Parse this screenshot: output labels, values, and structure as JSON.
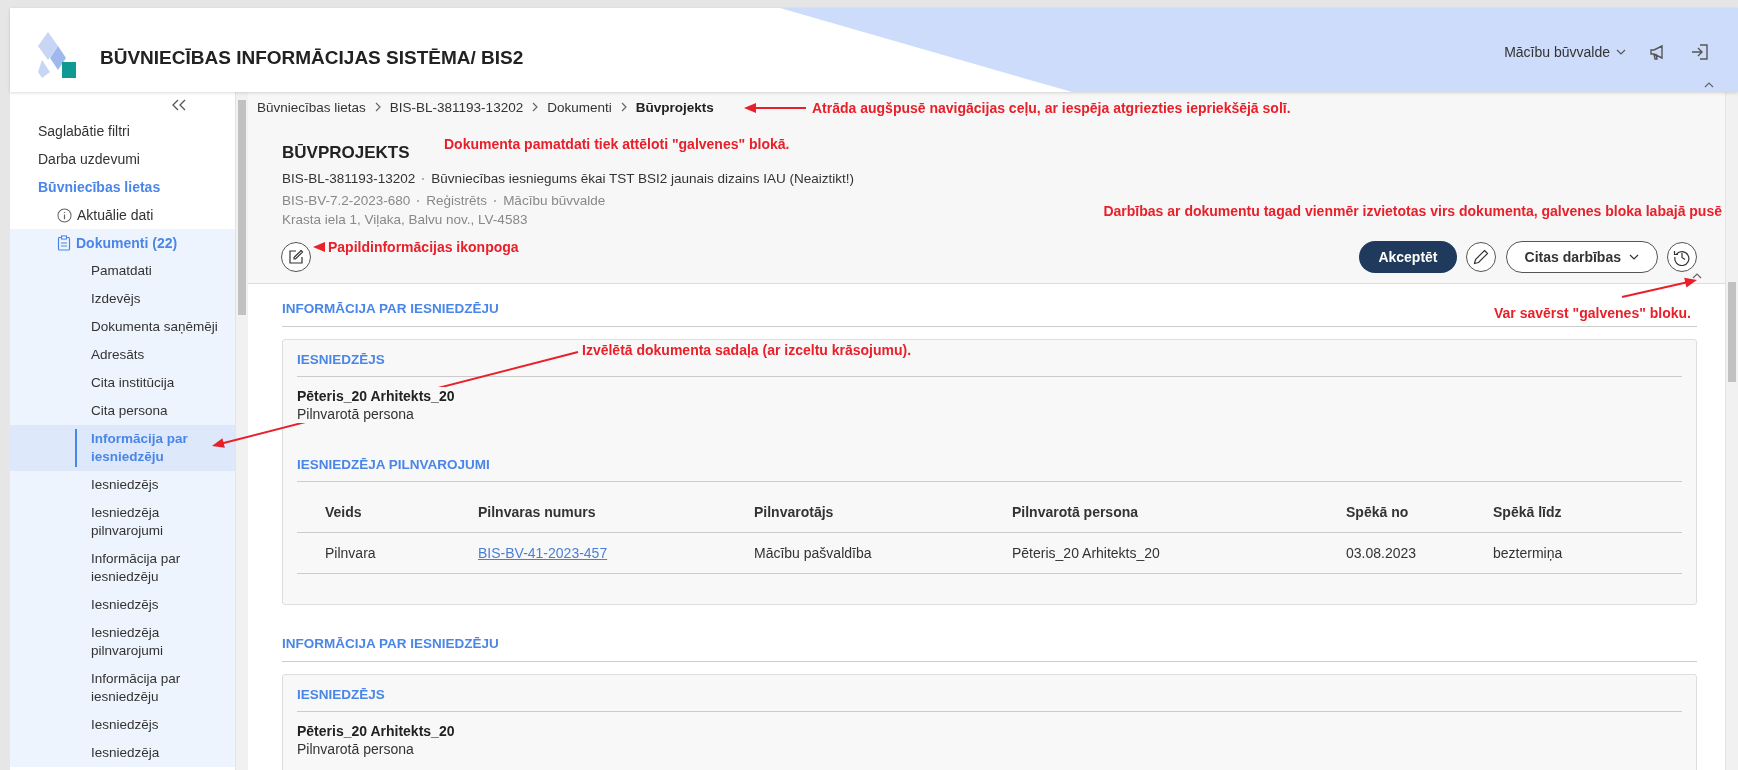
{
  "header": {
    "title": "BŪVNIECĪBAS INFORMĀCIJAS SISTĒMA/ BIS2",
    "user": "Mācību būvvalde"
  },
  "sidebar": {
    "items": [
      {
        "label": "Saglabātie filtri",
        "expanded": false
      },
      {
        "label": "Darba uzdevumi",
        "expanded": false
      },
      {
        "label": "Būvniecības lietas",
        "expanded": true,
        "children": [
          {
            "label": "Aktuālie dati",
            "kind": "info",
            "expanded": false
          },
          {
            "label": "Dokumenti (22)",
            "kind": "document",
            "expanded": true,
            "children": [
              {
                "label": "Pamatdati",
                "selected": false
              },
              {
                "label": "Izdevējs",
                "selected": false
              },
              {
                "label": "Dokumenta saņēmēji",
                "selected": false
              },
              {
                "label": "Adresāts",
                "selected": false
              },
              {
                "label": "Cita institūcija",
                "selected": false
              },
              {
                "label": "Cita persona",
                "selected": false
              },
              {
                "label": "Informācija par iesniedzēju",
                "selected": true
              },
              {
                "label": "Iesniedzējs",
                "selected": false
              },
              {
                "label": "Iesniedzēja pilnvarojumi",
                "selected": false
              },
              {
                "label": "Informācija par iesniedzēju",
                "selected": false
              },
              {
                "label": "Iesniedzējs",
                "selected": false
              },
              {
                "label": "Iesniedzēja pilnvarojumi",
                "selected": false
              },
              {
                "label": "Informācija par iesniedzēju",
                "selected": false
              },
              {
                "label": "Iesniedzējs",
                "selected": false
              },
              {
                "label": "Iesniedzēja",
                "selected": false
              }
            ]
          }
        ]
      }
    ]
  },
  "breadcrumb": [
    {
      "label": "Būvniecības lietas",
      "current": false
    },
    {
      "label": "BIS-BL-381193-13202",
      "current": false
    },
    {
      "label": "Dokumenti",
      "current": false
    },
    {
      "label": "Būvprojekts",
      "current": true
    }
  ],
  "document": {
    "title": "BŪVPROJEKTS",
    "meta_lines": [
      [
        "BIS-BL-381193-13202",
        "Būvniecības iesniegums ēkai TST BSI2 jaunais dizains IAU (Neaiztikt!)"
      ],
      [
        "BIS-BV-7.2-2023-680",
        "Reģistrēts",
        "Mācību būvvalde"
      ]
    ],
    "address": "Krasta iela 1, Viļaka, Balvu nov., LV-4583"
  },
  "actions": [
    {
      "kind": "primary",
      "label": "Akceptēt"
    },
    {
      "kind": "edit"
    },
    {
      "kind": "menu",
      "label": "Citas darbības"
    },
    {
      "kind": "history"
    }
  ],
  "sections": [
    {
      "title": "INFORMĀCIJA PAR IESNIEDZĒJU",
      "blocks": [
        {
          "kind": "person",
          "title": "IESNIEDZĒJS",
          "name": "Pēteris_20 Arhitekts_20",
          "role": "Pilnvarotā persona"
        },
        {
          "kind": "table",
          "title": "IESNIEDZĒJA PILNVAROJUMI",
          "columns": [
            "Veids",
            "Pilnvaras numurs",
            "Pilnvarotājs",
            "Pilnvarotā persona",
            "Spēkā no",
            "Spēkā līdz"
          ],
          "rows": [
            [
              {
                "text": "Pilnvara",
                "link": false
              },
              {
                "text": "BIS-BV-41-2023-457",
                "link": true
              },
              {
                "text": "Mācību pašvaldība",
                "link": false
              },
              {
                "text": "Pēteris_20 Arhitekts_20",
                "link": false
              },
              {
                "text": "03.08.2023",
                "link": false
              },
              {
                "text": "beztermiņa",
                "link": false
              }
            ]
          ]
        }
      ]
    },
    {
      "title": "INFORMĀCIJA PAR IESNIEDZĒJU",
      "blocks": [
        {
          "kind": "person",
          "title": "IESNIEDZĒJS",
          "name": "Pēteris_20 Arhitekts_20",
          "role": "Pilnvarotā persona"
        }
      ]
    }
  ],
  "annotations": [
    {
      "text": "Atrāda augšpusē navigācijas ceļu, ar iespēja atgriezties iepriekšējā solī."
    },
    {
      "text": "Dokumenta pamatdati tiek attēloti \"galvenes\" blokā."
    },
    {
      "text": "Darbības ar dokumentu tagad vienmēr izvietotas virs dokumenta, galvenes bloka labajā pusē"
    },
    {
      "text": "Papildinformācijas ikonpoga"
    },
    {
      "text": "Var savērst \"galvenes\" bloku."
    },
    {
      "text": "Izvēlētā dokumenta sadaļa (ar izceltu krāsojumu)."
    }
  ]
}
